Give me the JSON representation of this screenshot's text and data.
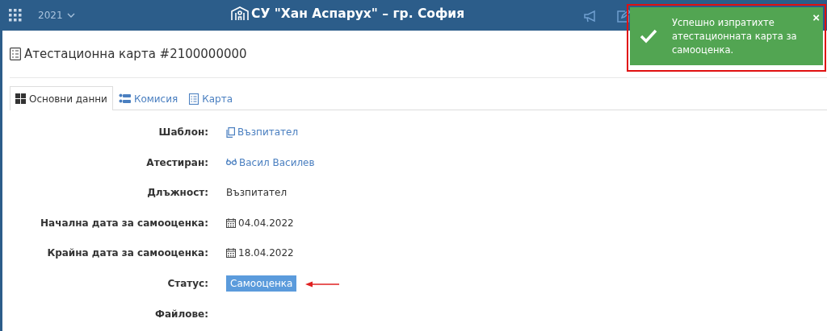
{
  "header": {
    "year": "2021",
    "school": "СУ \"Хан Аспарух\" – гр. София"
  },
  "page": {
    "title": "Атестационна карта #2100000000"
  },
  "tabs": [
    {
      "label": "Основни данни",
      "kind": "overview",
      "selected": true
    },
    {
      "label": "Комисия",
      "kind": "committee",
      "selected": false
    },
    {
      "label": "Карта",
      "kind": "card",
      "selected": false
    }
  ],
  "fields": [
    {
      "label": "Шаблон:",
      "kind": "template",
      "value": "Възпитател"
    },
    {
      "label": "Атестиран:",
      "kind": "person",
      "value": "Васил Василев"
    },
    {
      "label": "Длъжност:",
      "kind": "text",
      "value": "Възпитател"
    },
    {
      "label": "Начална дата за самооценка:",
      "kind": "date",
      "value": "04.04.2022"
    },
    {
      "label": "Крайна дата за самооценка:",
      "kind": "date",
      "value": "18.04.2022"
    },
    {
      "label": "Статус:",
      "kind": "status",
      "value": "Самооценка"
    },
    {
      "label": "Файлове:",
      "kind": "empty"
    }
  ],
  "toast": {
    "message": "Успешно изпратихте атестационната карта за самооценка.",
    "close": "×"
  }
}
